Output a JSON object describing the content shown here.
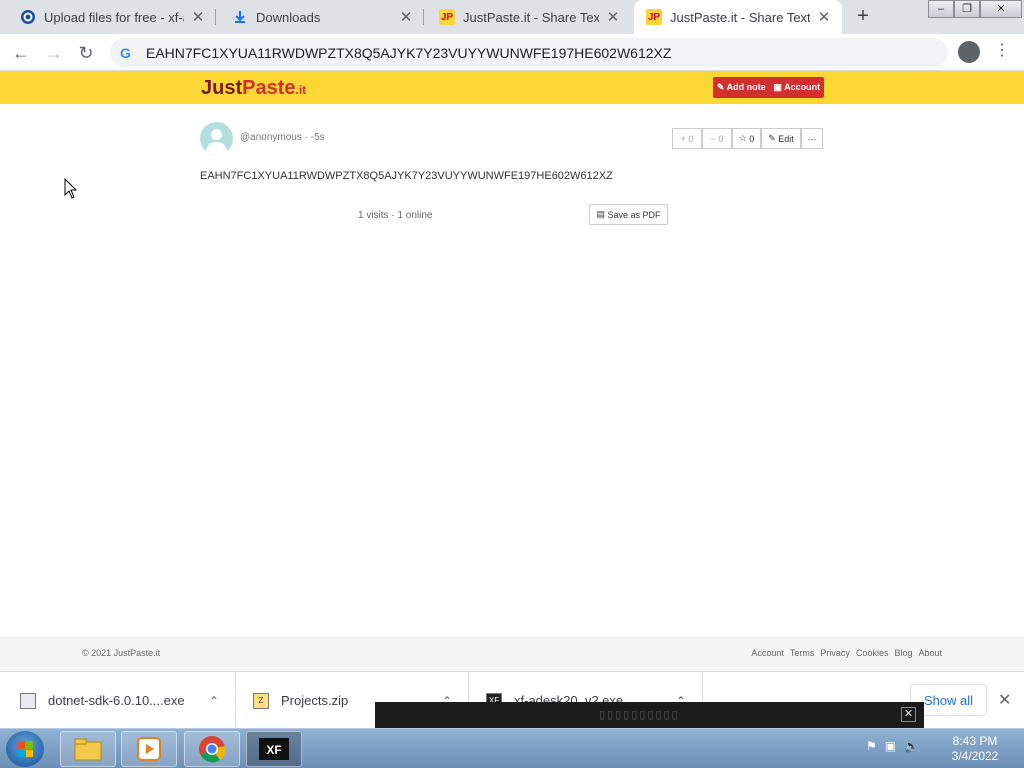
{
  "browser": {
    "tabs": [
      {
        "title": "Upload files for free - xf-ad",
        "icon": "cloud-upload-icon"
      },
      {
        "title": "Downloads",
        "icon": "download-icon"
      },
      {
        "title": "JustPaste.it - Share Text & I",
        "icon": "justpaste-icon"
      },
      {
        "title": "JustPaste.it - Share Text & I",
        "icon": "justpaste-icon",
        "active": true
      }
    ],
    "new_tab": "+",
    "url": "EAHN7FC1XYUA11RWDWPZTX8Q5AJYK7Y23VUYYWUNWFE197HE602W612XZ"
  },
  "site": {
    "logo_just": "Just",
    "logo_paste": "Paste",
    "logo_it": ".it",
    "add_note": "Add note",
    "account": "Account",
    "brand_color": "#fdd835"
  },
  "note": {
    "author": "@anonymous",
    "age": "-5s",
    "plus": "+ 0",
    "minus": "− 0",
    "fav": "0",
    "edit": "Edit",
    "more": "···",
    "content": "EAHN7FC1XYUA11RWDWPZTX8Q5AJYK7Y23VUYYWUNWFE197HE602W612XZ",
    "visits": "1 visits",
    "online": "1 online",
    "save_pdf": "Save as PDF"
  },
  "footer": {
    "copyright": "© 2021 JustPaste.it",
    "links": [
      "Account",
      "Terms",
      "Privacy",
      "Cookies",
      "Blog",
      "About"
    ]
  },
  "downloads": {
    "items": [
      {
        "name": "dotnet-sdk-6.0.10....exe"
      },
      {
        "name": "Projects.zip"
      },
      {
        "name": "xf-adesk20_v2.exe"
      }
    ],
    "show_all": "Show all"
  },
  "taskbar": {
    "time": "8:43 PM",
    "date": "3/4/2022",
    "apps": [
      "explorer-icon",
      "media-player-icon",
      "chrome-icon",
      "xf-icon"
    ]
  }
}
